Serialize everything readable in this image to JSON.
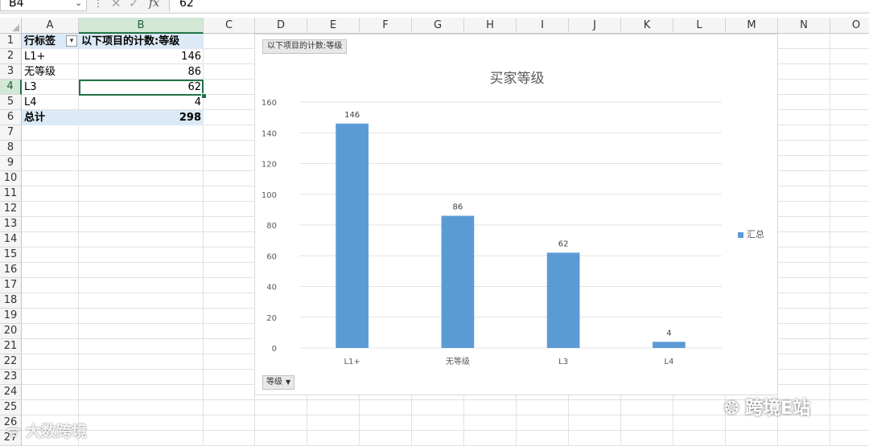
{
  "formula_bar": {
    "name_box": "B4",
    "fx_label": "fx",
    "value": "62"
  },
  "columns": [
    "A",
    "B",
    "C",
    "D",
    "E",
    "F",
    "G",
    "H",
    "I",
    "J",
    "K",
    "L",
    "M",
    "N",
    "O"
  ],
  "rows": [
    "1",
    "2",
    "3",
    "4",
    "5",
    "6",
    "7",
    "8",
    "9",
    "10",
    "11",
    "12",
    "13",
    "14",
    "15",
    "16",
    "17",
    "18",
    "19",
    "20",
    "21",
    "22",
    "23",
    "24",
    "25",
    "26",
    "27"
  ],
  "selected": {
    "column": "B",
    "row": "4"
  },
  "pivot": {
    "header_a": "行标签",
    "header_b": "以下项目的计数:等级",
    "filter_icon": "filter-dropdown-icon",
    "rows": [
      {
        "label": "L1+",
        "value": "146"
      },
      {
        "label": "无等级",
        "value": "86"
      },
      {
        "label": "L3",
        "value": "62"
      },
      {
        "label": "L4",
        "value": "4"
      }
    ],
    "total_label": "总计",
    "total_value": "298"
  },
  "chart_data": {
    "type": "bar",
    "title": "买家等级",
    "field_button": "以下项目的计数:等级",
    "axis_field_button": "等级",
    "categories": [
      "L1+",
      "无等级",
      "L3",
      "L4"
    ],
    "series": [
      {
        "name": "汇总",
        "values": [
          146,
          86,
          62,
          4
        ],
        "color": "#5b9bd5"
      }
    ],
    "ylim": [
      0,
      160
    ],
    "yticks": [
      0,
      20,
      40,
      60,
      80,
      100,
      120,
      140,
      160
    ],
    "grid": true,
    "legend_position": "right",
    "data_labels": true
  },
  "watermarks": {
    "left": "大数跨境",
    "right": "跨境E站"
  }
}
